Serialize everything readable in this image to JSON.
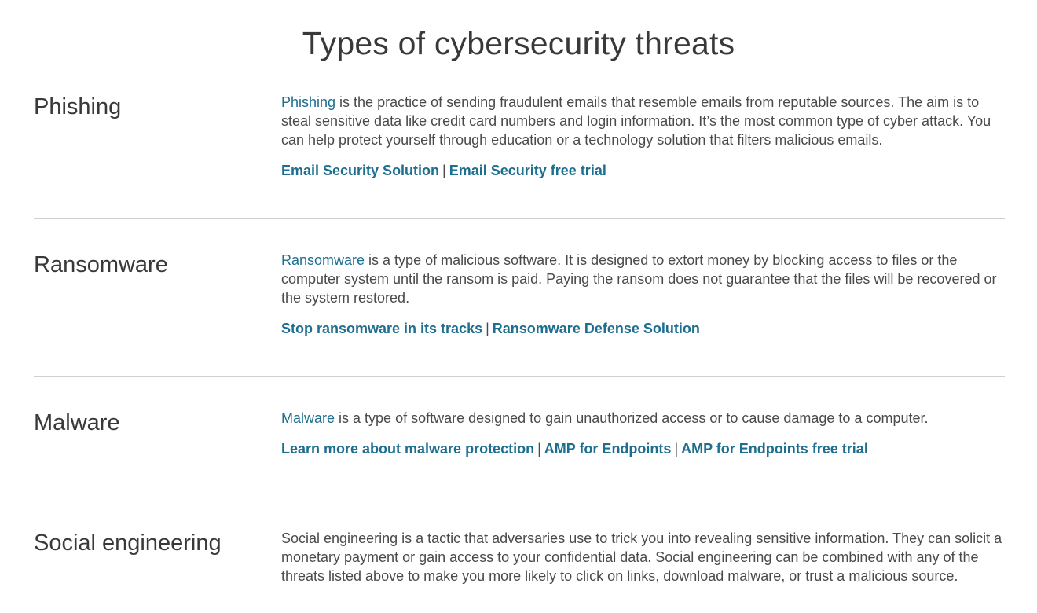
{
  "page_title": "Types of cybersecurity threats",
  "colors": {
    "link": "#1d6e8f",
    "text": "#4a4a4a",
    "heading": "#39393b",
    "divider": "#d0d0d0"
  },
  "threats": [
    {
      "heading": "Phishing",
      "lead_link": "Phishing",
      "description": " is the practice of sending fraudulent emails that resemble emails from reputable sources. The aim is to steal sensitive data like credit card numbers and login information. It’s the most common type of cyber attack. You can help protect yourself through education or a technology solution that filters malicious emails.",
      "links": [
        "Email Security Solution",
        "Email Security free trial"
      ],
      "separator": "|"
    },
    {
      "heading": "Ransomware",
      "lead_link": "Ransomware",
      "description": " is a type of malicious software. It is designed to extort money by blocking access to files or the computer system until the ransom is paid. Paying the ransom does not guarantee that the files will be recovered or the system restored.",
      "links": [
        "Stop ransomware in its tracks",
        "Ransomware Defense Solution"
      ],
      "separator": "|"
    },
    {
      "heading": "Malware",
      "lead_link": "Malware",
      "description": " is a type of software designed to gain unauthorized access or to cause damage to a computer.",
      "links": [
        "Learn more about malware protection",
        "AMP for Endpoints",
        "AMP for Endpoints free trial"
      ],
      "separator": "|"
    },
    {
      "heading": "Social engineering",
      "description": "Social engineering is a tactic that adversaries use to trick you into revealing sensitive information. They can solicit a monetary payment or gain access to your confidential data. Social engineering can be combined with any of the threats listed above to make you more likely to click on links, download malware, or trust a malicious source."
    }
  ]
}
